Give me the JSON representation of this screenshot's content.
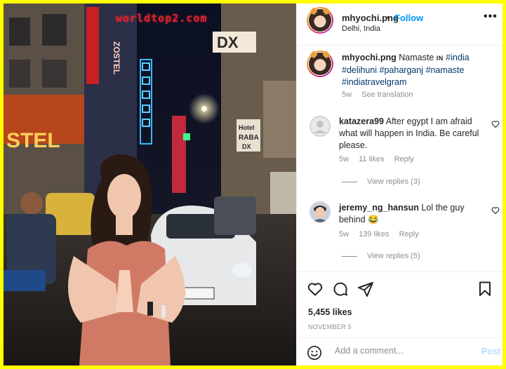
{
  "watermark": "worldtop2.com",
  "post": {
    "username": "mhyochi.png",
    "dot": "•",
    "follow_label": "Follow",
    "location": "Delhi, India",
    "more_label": "•••"
  },
  "caption": {
    "username": "mhyochi.png",
    "text": "Namaste",
    "in_word": "IN",
    "tags": [
      "#india",
      "#delihuni",
      "#paharganj",
      "#namaste",
      "#indiatravelgram"
    ],
    "age": "5w",
    "see_translation": "See translation"
  },
  "comments": [
    {
      "username": "katazera99",
      "text": "After egypt I am afraid what will happen in India. Be careful please.",
      "age": "5w",
      "likes": "11 likes",
      "reply_label": "Reply",
      "view_replies": "View replies (3)"
    },
    {
      "username": "jeremy_ng_hansun",
      "text": "Lol the guy behind 😂",
      "age": "5w",
      "likes": "139 likes",
      "reply_label": "Reply",
      "view_replies": "View replies (5)"
    }
  ],
  "actions": {
    "like_icon": "heart-icon",
    "comment_icon": "comment-icon",
    "share_icon": "share-icon",
    "save_icon": "bookmark-icon"
  },
  "likes_count": "5,455 likes",
  "date": "NOVEMBER 5",
  "comment_input": {
    "placeholder": "Add a comment...",
    "post_label": "Post"
  },
  "colors": {
    "accent": "#0095f6",
    "hashtag": "#00376b",
    "muted": "#8e8e8e",
    "border_frame": "#ffff00"
  }
}
